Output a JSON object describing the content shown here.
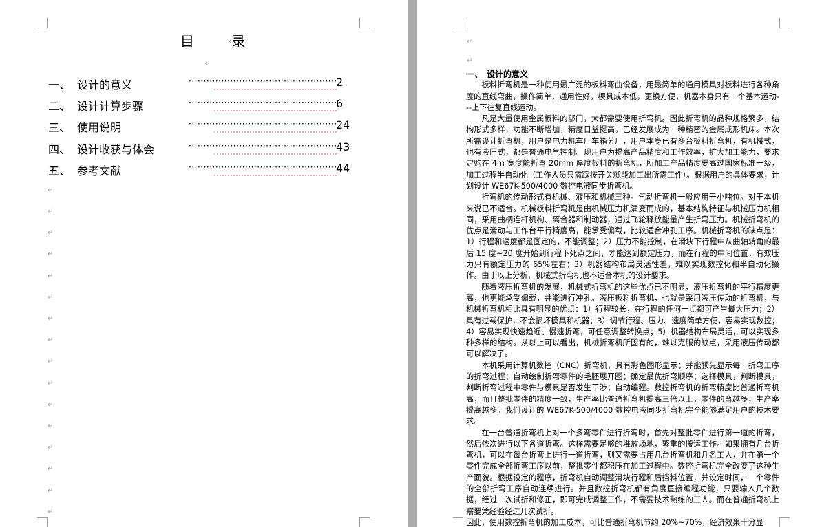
{
  "toc": {
    "title": "目    录",
    "items": [
      {
        "num": "一、",
        "label": "设计的意义",
        "page": "2"
      },
      {
        "num": "二、",
        "label": "设计计算步骤",
        "page": "6"
      },
      {
        "num": "三、",
        "label": "使用说明",
        "page": "24"
      },
      {
        "num": "四、",
        "label": "设计收获与体会",
        "page": "43"
      },
      {
        "num": "五、",
        "label": "参考文献",
        "page": "44"
      }
    ],
    "leader": "·································································"
  },
  "body": {
    "heading": "一、　设计的意义",
    "paragraphs": [
      "板料折弯机是一种使用最广泛的板料弯曲设备，用最简单的通用模具对板料进行各种角度的直线弯曲，操作简单，通用性好，模具成本低，更换方便，机器本身只有一个基本运动---上下往复直线运动。",
      "凡是大量使用金属板料的部门，大都需要使用折弯机。因此折弯机的品种规格繁多，结构形式多样，功能不断增加，精度日益提高，已经发展成为一种精密的金属成形机床。本次所需设计折弯机，用户是电力机车厂车箱分厂，用户本身已有多台板料折弯机，有机械式，也有液压式，都是普通电气控制。现用户为提高产品精度和工作效率，扩大加工能力，要求定购在 4m 宽度能折弯 20mm 厚度板料的折弯机，所加工产品精度要高过国家标准一级，加工过程半自动化（工作人员只需踩按开关就能加工出所需工件）。根据用户的具体要求，计划设计 WE67K-500/4000 数控电液同步折弯机。",
      "折弯机的传动形式有机械、液压和机械三种。气动折弯机一般应用于小吨位。对于本机来说已不适合。机械板料折弯机是由机械压力机演变而成的，基本结构特征与机械压力机相同，采用曲柄连杆机构、离合器和制动器，通过飞轮释放能量产生折弯压力。机械折弯机的优点是滑动与工作台平行精度高，能承受偏载，比较适合冲孔工序。机械折弯机的缺点是：1）行程和速度都是固定的，不能调整；2）压力不能控制，在滑块下行程中从曲轴转角的最后 15 度~20 度开始到行程下死点之间，才能达到额定压力，而在行程的中间位置，有效压力只有额定压力的 65%左右；3）机器结构布局灵活性差，难以实现数控化和半自动化操作。由于以上分析，机械式折弯机也不适合本机的设计要求。",
      "随着液压折弯机的发展，机械式折弯机的这些优点已不明显，液压折弯机的平行精度更高，也更能承受偏载，并能进行冲孔。液压板料折弯机，也就是采用液压传动的折弯机，与机械折弯机相比具有明显的优点：1）行程较长，在行程的任何一点都可产生最大压力；2）具有过载保护，不会损坏模具和机器；3）调节行程、压力、速度简单方便，容易实现数控；4）容易实现快速趋近、慢速折弯，可任意调整转换点；5）机器结构布局灵活，可以实现多种多样的结构。从以上可以看出，机械折弯机所固有的，难以克服的缺点，采用液压传动都可以解决了。",
      "本机采用计算机数控（CNC）折弯机，具有彩色图形显示；并能预先显示每一折弯工序的折弯过程；自动绘制折弯零件的毛胚展开图；确定最优折弯顺序；选择模具，判断模具，判断折弯过程中零件与模具是否发生干涉；自动编程。数控折弯机的折弯精度比普通折弯机高，而且整批零件的精度一致，生产率比普通折弯机提高三倍以上，零件的弯越多，生产率提高越多。我们设计的 WE67K-500/4000 数控电液同步折弯机完全能够满足用户的技术要求。",
      "在一台普通折弯机上对一个多弯零件进行折弯时，首先对整批零件进行第一道的折弯，然后依次进行以下各道折弯。这样需要足够的堆放场地，繁重的搬运工作。如果拥有几台折弯机，可以在每台折弯上进行一道折弯，则又需要占用几台折弯机和几名工人，并在第一个零件完成全部折弯工序以前，整批零件都积压在加工过程中。数控折弯机完全改变了这种生产面貌。根据设定的程序，折弯机自动调整滑块行程和后挡料位置，并设定时间，一个零件的全部折弯工序自动连续进行。并且数控折弯机都有角度直接编程功能，只要输入几个数据，经过一次试折和修正，即可完成调整工作，不需要技术熟练的工人。而在普通折弯机上需要凭经验经过几次试折。",
      "因此，使用数控折弯机的加工成本，可比普通折弯机节约 20%~70%，经济效果十分显"
    ]
  }
}
